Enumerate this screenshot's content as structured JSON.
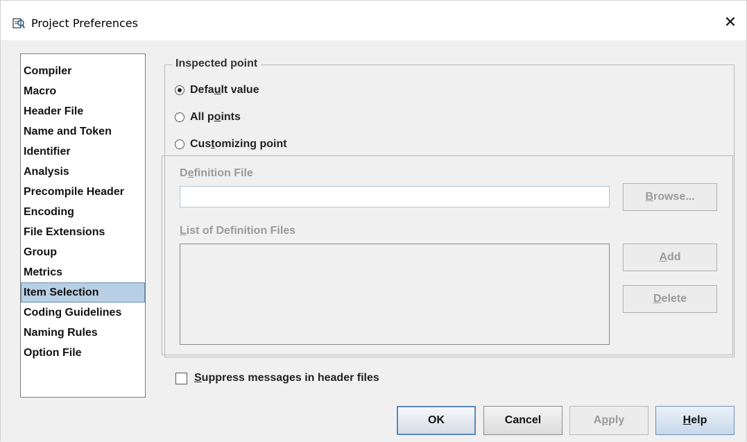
{
  "window": {
    "title": "Project Preferences",
    "close_icon": "close-icon",
    "title_icon": "preferences-icon"
  },
  "nav": {
    "items": [
      {
        "label": "Compiler"
      },
      {
        "label": "Macro"
      },
      {
        "label": "Header File"
      },
      {
        "label": "Name and Token"
      },
      {
        "label": "Identifier"
      },
      {
        "label": "Analysis"
      },
      {
        "label": "Precompile Header"
      },
      {
        "label": "Encoding"
      },
      {
        "label": "File Extensions"
      },
      {
        "label": "Group"
      },
      {
        "label": "Metrics"
      },
      {
        "label": "Item Selection"
      },
      {
        "label": "Coding Guidelines"
      },
      {
        "label": "Naming Rules"
      },
      {
        "label": "Option File"
      }
    ],
    "selected": "Item Selection"
  },
  "inspected": {
    "legend": "Inspected point",
    "options": [
      {
        "label": "Default value",
        "mnemonic": "u",
        "checked": true
      },
      {
        "label": "All points",
        "mnemonic": "o",
        "checked": false
      },
      {
        "label": "Customizing point",
        "mnemonic": "t",
        "checked": false
      }
    ],
    "definition_file_label": "Definition File",
    "definition_file_value": "",
    "browse_label": "Browse...",
    "list_label": "List of Definition Files",
    "add_label": "Add",
    "delete_label": "Delete"
  },
  "suppress": {
    "label": "Suppress messages in header files",
    "checked": false
  },
  "footer": {
    "ok_label": "OK",
    "cancel_label": "Cancel",
    "apply_label": "Apply",
    "help_label": "Help"
  },
  "colors": {
    "selection": "#b8cfe5",
    "default_border": "#5a87b8",
    "disabled_text": "#9a9a9a"
  }
}
